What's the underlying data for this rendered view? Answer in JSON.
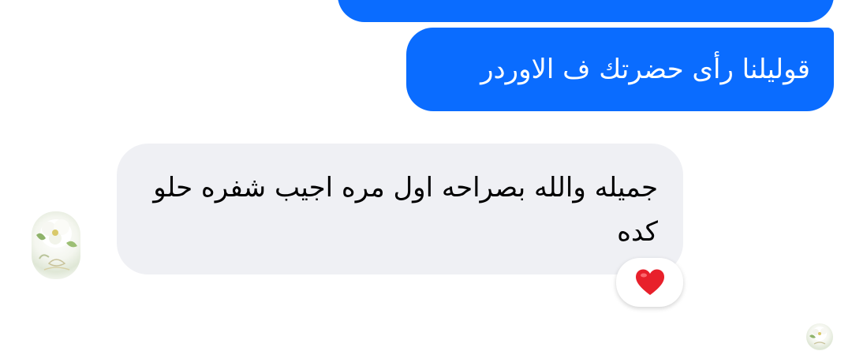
{
  "messages": {
    "sent": {
      "text": "قوليلنا رأى حضرتك ف الاوردر"
    },
    "received": {
      "text": "جميله والله بصراحه اول مره اجيب شفره حلو كده",
      "reaction": "heart"
    }
  },
  "colors": {
    "outgoing_bubble": "#0a6cff",
    "incoming_bubble": "#eff0f4",
    "heart": "#e8202b"
  },
  "icons": {
    "reaction": "heart-icon",
    "avatar": "contact-avatar",
    "seen": "seen-avatar"
  }
}
